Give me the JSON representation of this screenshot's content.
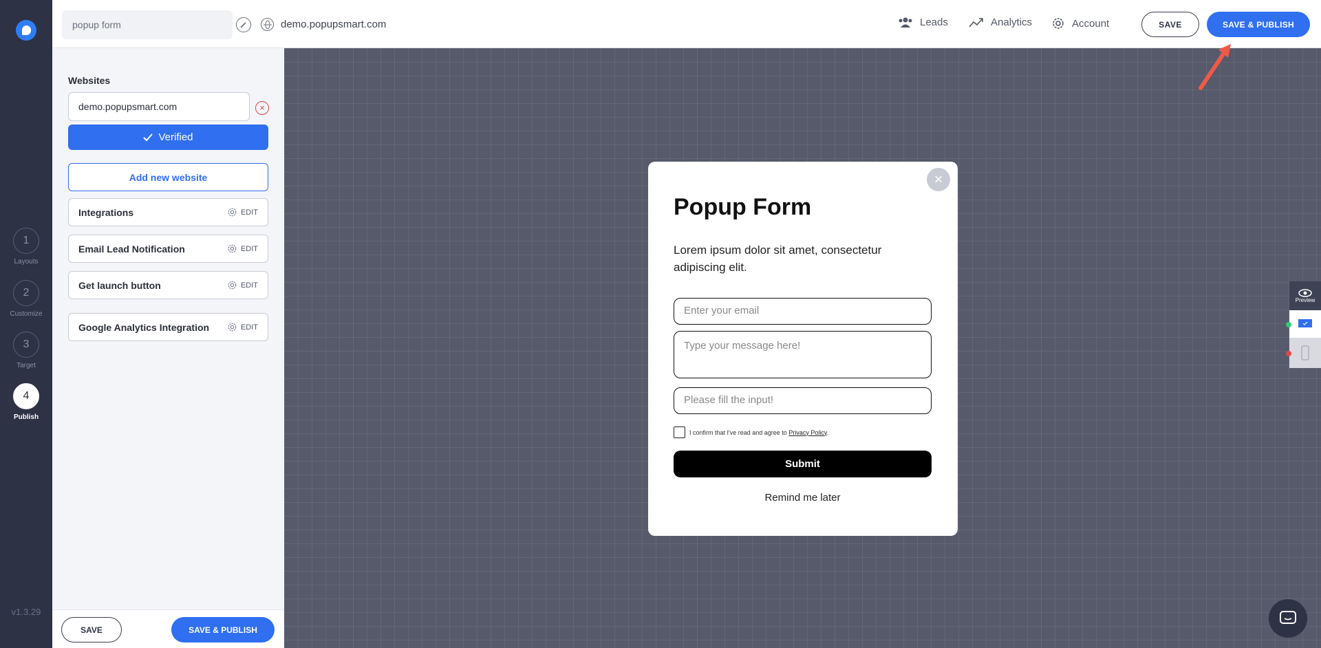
{
  "app": {
    "name": "Popupsmart",
    "version": "v1.3.29",
    "accent": "#2f6ff0"
  },
  "topbar": {
    "campaign_name": "popup form",
    "domain": "demo.popupsmart.com",
    "nav": [
      {
        "label": "Leads",
        "icon": "users-icon"
      },
      {
        "label": "Analytics",
        "icon": "analytics-icon"
      },
      {
        "label": "Account",
        "icon": "gear-icon"
      }
    ],
    "save_label": "SAVE",
    "publish_label": "SAVE & PUBLISH"
  },
  "steps": [
    {
      "num": "1",
      "label": "Layouts"
    },
    {
      "num": "2",
      "label": "Customize"
    },
    {
      "num": "3",
      "label": "Target"
    },
    {
      "num": "4",
      "label": "Publish",
      "active": true
    }
  ],
  "panel": {
    "websites_heading": "Websites",
    "website_value": "demo.popupsmart.com",
    "verified_label": "Verified",
    "add_website_label": "Add new website",
    "rows": [
      {
        "label": "Integrations",
        "edit": "EDIT"
      },
      {
        "label": "Email Lead Notification",
        "edit": "EDIT"
      },
      {
        "label": "Get launch button",
        "edit": "EDIT"
      },
      {
        "label": "Google Analytics Integration",
        "edit": "EDIT"
      }
    ],
    "save_label": "SAVE",
    "publish_label": "SAVE & PUBLISH"
  },
  "popup": {
    "title": "Popup Form",
    "description": "Lorem ipsum dolor sit amet, consectetur adipiscing elit.",
    "email_placeholder": "Enter your email",
    "message_placeholder": "Type your message here!",
    "input_placeholder": "Please fill the input!",
    "consent_text": "I confirm that I've read and agree to",
    "privacy_link": "Privacy Policy",
    "consent_end": ".",
    "submit_label": "Submit",
    "remind_label": "Remind me later"
  },
  "tools": {
    "preview_label": "Preview"
  }
}
